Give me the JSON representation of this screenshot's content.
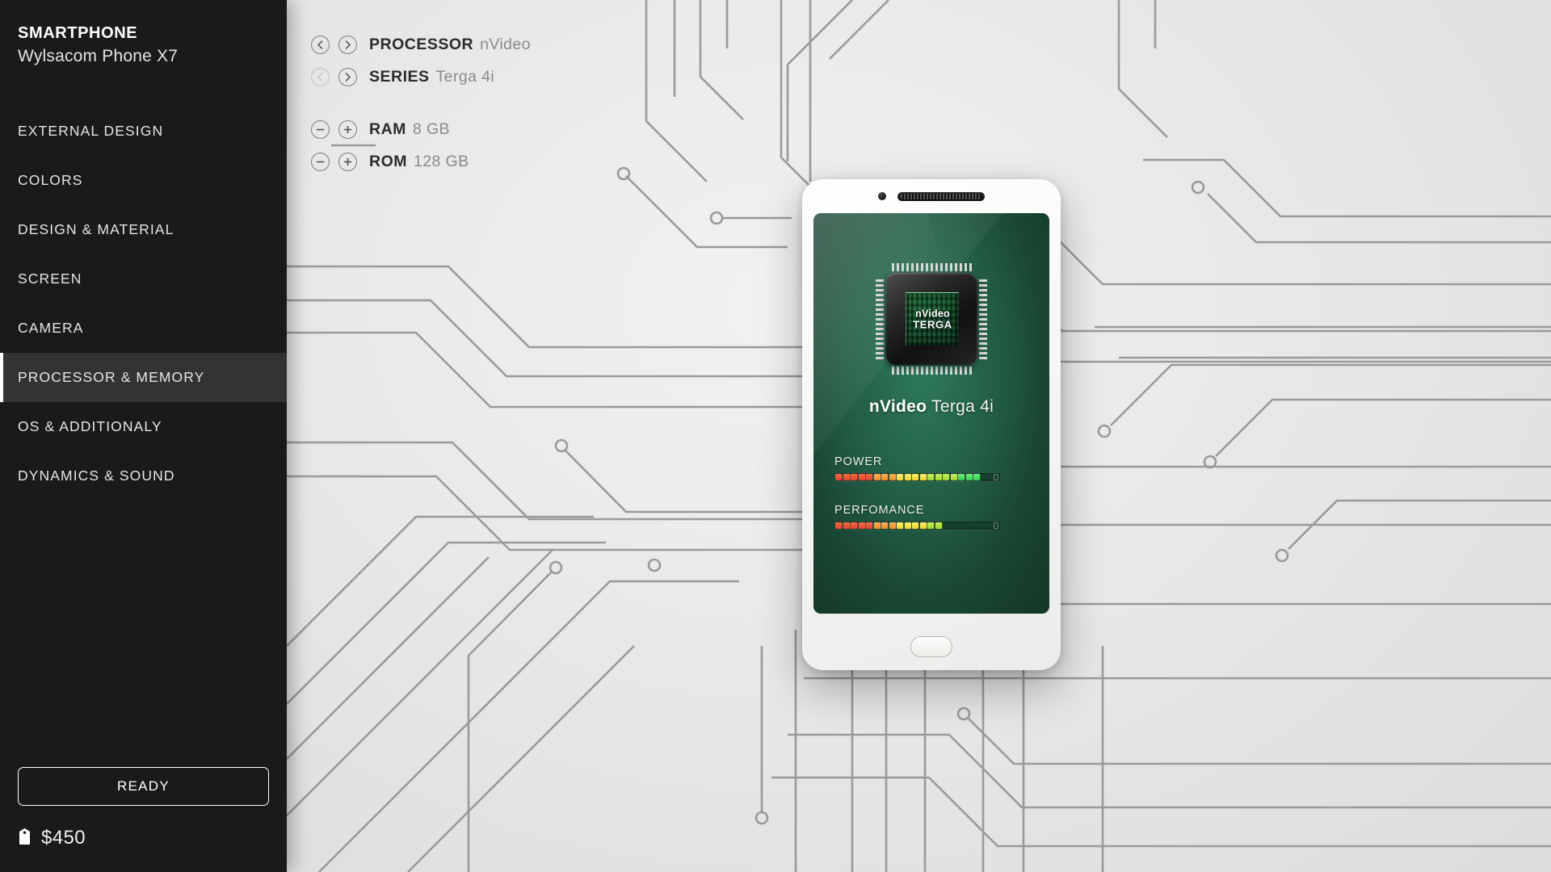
{
  "sidebar": {
    "brand_title": "SMARTPHONE",
    "brand_subtitle": "Wylsacom Phone X7",
    "items": [
      {
        "label": "EXTERNAL DESIGN",
        "active": false
      },
      {
        "label": "COLORS",
        "active": false
      },
      {
        "label": "DESIGN & MATERIAL",
        "active": false
      },
      {
        "label": "SCREEN",
        "active": false
      },
      {
        "label": "CAMERA",
        "active": false
      },
      {
        "label": "PROCESSOR & MEMORY",
        "active": true
      },
      {
        "label": "OS & ADDITIONALY",
        "active": false
      },
      {
        "label": "DYNAMICS & SOUND",
        "active": false
      }
    ],
    "ready_button": "READY",
    "price": "$450",
    "price_icon": "price-tag-icon"
  },
  "options": {
    "selectors": [
      {
        "label": "PROCESSOR",
        "value": "nVideo",
        "prev_icon": "chevron-left-icon",
        "next_icon": "chevron-right-icon",
        "prev_disabled": false
      },
      {
        "label": "SERIES",
        "value": "Terga 4i",
        "prev_icon": "chevron-left-icon",
        "next_icon": "chevron-right-icon",
        "prev_disabled": true
      }
    ],
    "steppers": [
      {
        "label": "RAM",
        "value": "8 GB",
        "minus_icon": "minus-icon",
        "plus_icon": "plus-icon"
      },
      {
        "label": "ROM",
        "value": "128 GB",
        "minus_icon": "minus-icon",
        "plus_icon": "plus-icon"
      }
    ]
  },
  "phone": {
    "camera_icon": "front-camera-icon",
    "speaker_icon": "earpiece-speaker-icon",
    "home_button_icon": "home-button-icon",
    "chip": {
      "line1": "nVideo",
      "line2": "TERGA"
    },
    "chip_name_brand": "nVideo",
    "chip_name_model": " Terga 4i",
    "meters": [
      {
        "label": "POWER",
        "segments": 19,
        "total": 24,
        "percent": 79
      },
      {
        "label": "PERFOMANCE",
        "segments": 14,
        "total": 24,
        "percent": 58
      }
    ]
  },
  "colors": {
    "sidebar_bg": "#1a1a1a",
    "sidebar_active_bg": "#333333",
    "accent_white": "#ffffff",
    "canvas_bg": "#e8e8e8",
    "circuit_line": "#9a9a9a",
    "screen_green": "#236046",
    "label_dark": "#2b2b2b",
    "value_gray": "#8a8a8a"
  }
}
